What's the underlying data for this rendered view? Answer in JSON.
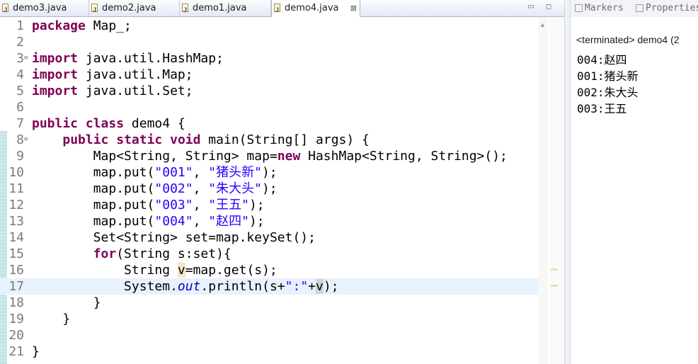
{
  "editor": {
    "tabs": [
      {
        "label": "demo3.java",
        "active": false
      },
      {
        "label": "demo2.java",
        "active": false
      },
      {
        "label": "demo1.java",
        "active": false
      },
      {
        "label": "demo4.java",
        "active": true,
        "close": "⊠"
      }
    ],
    "lines": [
      {
        "n": "1",
        "fold": "",
        "segs": [
          {
            "t": "package",
            "c": "kw"
          },
          {
            "t": " Map_;"
          }
        ]
      },
      {
        "n": "2",
        "fold": "",
        "segs": []
      },
      {
        "n": "3",
        "fold": "⊖",
        "segs": [
          {
            "t": "import",
            "c": "kw"
          },
          {
            "t": " java.util.HashMap;"
          }
        ]
      },
      {
        "n": "4",
        "fold": "",
        "segs": [
          {
            "t": "import",
            "c": "kw"
          },
          {
            "t": " java.util.Map;"
          }
        ]
      },
      {
        "n": "5",
        "fold": "",
        "segs": [
          {
            "t": "import",
            "c": "kw"
          },
          {
            "t": " java.util.Set;"
          }
        ]
      },
      {
        "n": "6",
        "fold": "",
        "segs": []
      },
      {
        "n": "7",
        "fold": "",
        "segs": [
          {
            "t": "public",
            "c": "kw"
          },
          {
            "t": " "
          },
          {
            "t": "class",
            "c": "kw"
          },
          {
            "t": " demo4 {"
          }
        ]
      },
      {
        "n": "8",
        "fold": "⊖",
        "segs": [
          {
            "t": "    "
          },
          {
            "t": "public",
            "c": "kw"
          },
          {
            "t": " "
          },
          {
            "t": "static",
            "c": "kw"
          },
          {
            "t": " "
          },
          {
            "t": "void",
            "c": "kw"
          },
          {
            "t": " main(String[] args) {"
          }
        ]
      },
      {
        "n": "9",
        "fold": "",
        "segs": [
          {
            "t": "        Map<String, String> map="
          },
          {
            "t": "new",
            "c": "kw"
          },
          {
            "t": " HashMap<String, String>();"
          }
        ]
      },
      {
        "n": "10",
        "fold": "",
        "segs": [
          {
            "t": "        map.put("
          },
          {
            "t": "\"001\"",
            "c": "str"
          },
          {
            "t": ", "
          },
          {
            "t": "\"猪头新\"",
            "c": "str"
          },
          {
            "t": ");"
          }
        ]
      },
      {
        "n": "11",
        "fold": "",
        "segs": [
          {
            "t": "        map.put("
          },
          {
            "t": "\"002\"",
            "c": "str"
          },
          {
            "t": ", "
          },
          {
            "t": "\"朱大头\"",
            "c": "str"
          },
          {
            "t": ");"
          }
        ]
      },
      {
        "n": "12",
        "fold": "",
        "segs": [
          {
            "t": "        map.put("
          },
          {
            "t": "\"003\"",
            "c": "str"
          },
          {
            "t": ", "
          },
          {
            "t": "\"王五\"",
            "c": "str"
          },
          {
            "t": ");"
          }
        ]
      },
      {
        "n": "13",
        "fold": "",
        "segs": [
          {
            "t": "        map.put("
          },
          {
            "t": "\"004\"",
            "c": "str"
          },
          {
            "t": ", "
          },
          {
            "t": "\"赵四\"",
            "c": "str"
          },
          {
            "t": ");"
          }
        ]
      },
      {
        "n": "14",
        "fold": "",
        "segs": [
          {
            "t": "        Set<String> set=map.keySet();"
          }
        ]
      },
      {
        "n": "15",
        "fold": "",
        "segs": [
          {
            "t": "        "
          },
          {
            "t": "for",
            "c": "kw"
          },
          {
            "t": "(String s:set){"
          }
        ]
      },
      {
        "n": "16",
        "fold": "",
        "segs": [
          {
            "t": "            String "
          },
          {
            "t": "v",
            "c": "hl"
          },
          {
            "t": "=map.get(s);"
          }
        ]
      },
      {
        "n": "17",
        "fold": "",
        "current": true,
        "segs": [
          {
            "t": "            System."
          },
          {
            "t": "out",
            "c": "fld"
          },
          {
            "t": ".println("
          },
          {
            "t": "s+"
          },
          {
            "t": "\":\"",
            "c": "str"
          },
          {
            "t": "+"
          },
          {
            "t": "v",
            "c": "hl2"
          },
          {
            "t": ");"
          }
        ]
      },
      {
        "n": "18",
        "fold": "",
        "segs": [
          {
            "t": "        }"
          }
        ]
      },
      {
        "n": "19",
        "fold": "",
        "segs": [
          {
            "t": "    }"
          }
        ]
      },
      {
        "n": "20",
        "fold": "",
        "segs": []
      },
      {
        "n": "21",
        "fold": "",
        "segs": [
          {
            "t": "}"
          }
        ]
      }
    ]
  },
  "console": {
    "tabs": [
      "Markers",
      "Properties"
    ],
    "terminated": "<terminated> demo4 (2",
    "output": [
      "004:赵四",
      "001:猪头新",
      "002:朱大头",
      "003:王五"
    ]
  },
  "colors": {
    "keyword": "#7f0055",
    "string": "#2a00ff",
    "field": "#0000c0",
    "current_line": "#e8f2fe"
  }
}
